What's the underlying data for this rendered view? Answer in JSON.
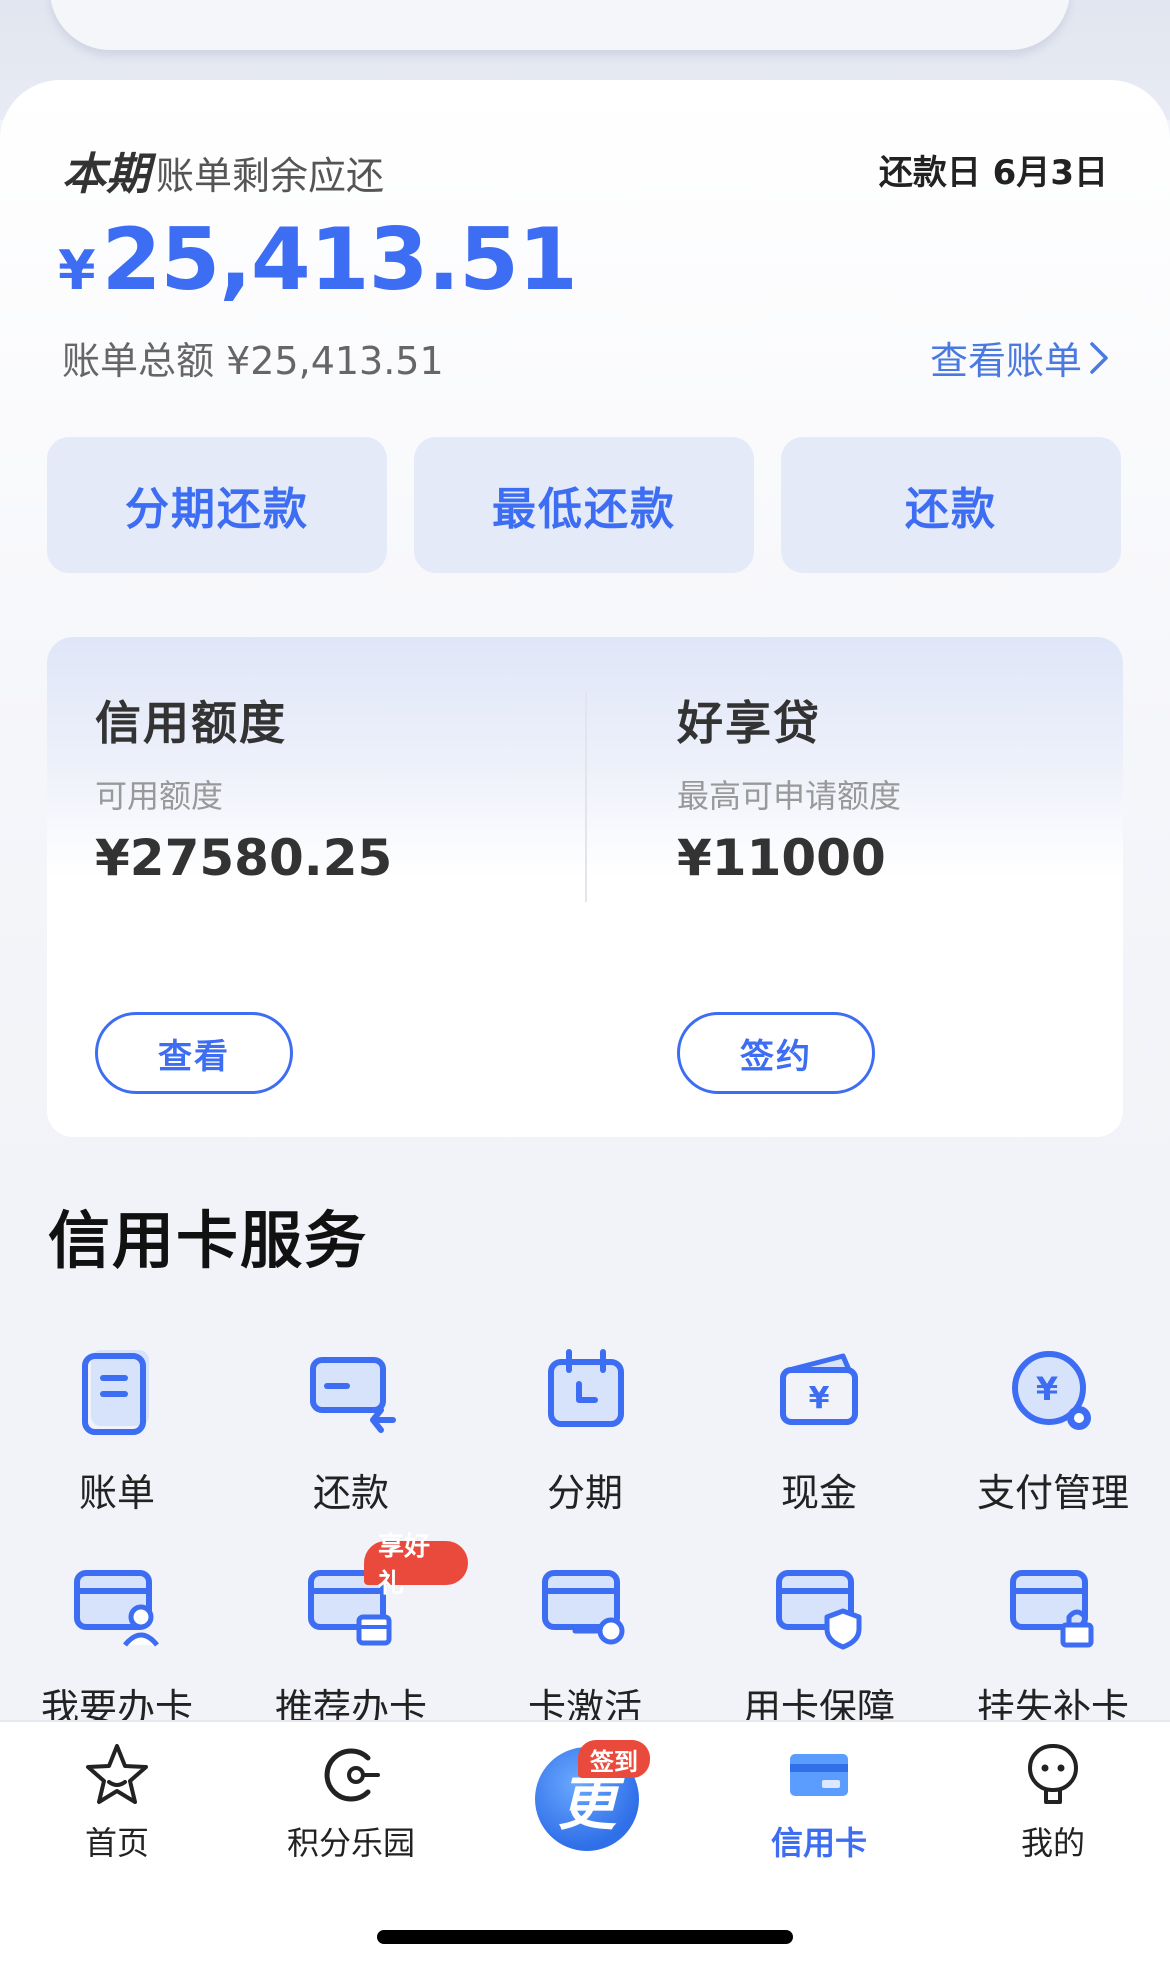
{
  "bill": {
    "title_strong": "本期",
    "title_rest": "账单剩余应还",
    "due_date": "还款日 6月3日",
    "currency": "¥",
    "amount": "25,413.51",
    "total": "账单总额 ¥25,413.51",
    "view_bill": "查看账单",
    "accent_color": "#3d6df2"
  },
  "actions": [
    {
      "label": "分期还款"
    },
    {
      "label": "最低还款"
    },
    {
      "label": "还款"
    }
  ],
  "credit": {
    "limit": {
      "title": "信用额度",
      "sub": "可用额度",
      "value": "¥27580.25",
      "button": "查看"
    },
    "loan": {
      "title": "好享贷",
      "sub": "最高可申请额度",
      "value": "¥11000",
      "button": "签约"
    }
  },
  "services": {
    "title": "信用卡服务",
    "items": [
      {
        "label": "账单",
        "icon": "bill-icon"
      },
      {
        "label": "还款",
        "icon": "repay-icon"
      },
      {
        "label": "分期",
        "icon": "calendar-icon"
      },
      {
        "label": "现金",
        "icon": "cash-wallet-icon"
      },
      {
        "label": "支付管理",
        "icon": "payment-settings-icon"
      },
      {
        "label": "我要办卡",
        "icon": "apply-card-icon"
      },
      {
        "label": "推荐办卡",
        "icon": "recommend-card-icon",
        "badge": "享好礼"
      },
      {
        "label": "卡激活",
        "icon": "card-activate-icon"
      },
      {
        "label": "用卡保障",
        "icon": "card-shield-icon"
      },
      {
        "label": "挂失补卡",
        "icon": "card-lock-icon"
      }
    ]
  },
  "tabbar": {
    "items": [
      {
        "label": "首页",
        "icon": "star-home-icon"
      },
      {
        "label": "积分乐园",
        "icon": "points-icon"
      },
      {
        "label": "",
        "icon": "center-logo-icon"
      },
      {
        "label": "信用卡",
        "icon": "credit-card-icon",
        "active": true
      },
      {
        "label": "我的",
        "icon": "profile-icon"
      }
    ],
    "center_badge": "签到",
    "center_glyph": "更"
  }
}
